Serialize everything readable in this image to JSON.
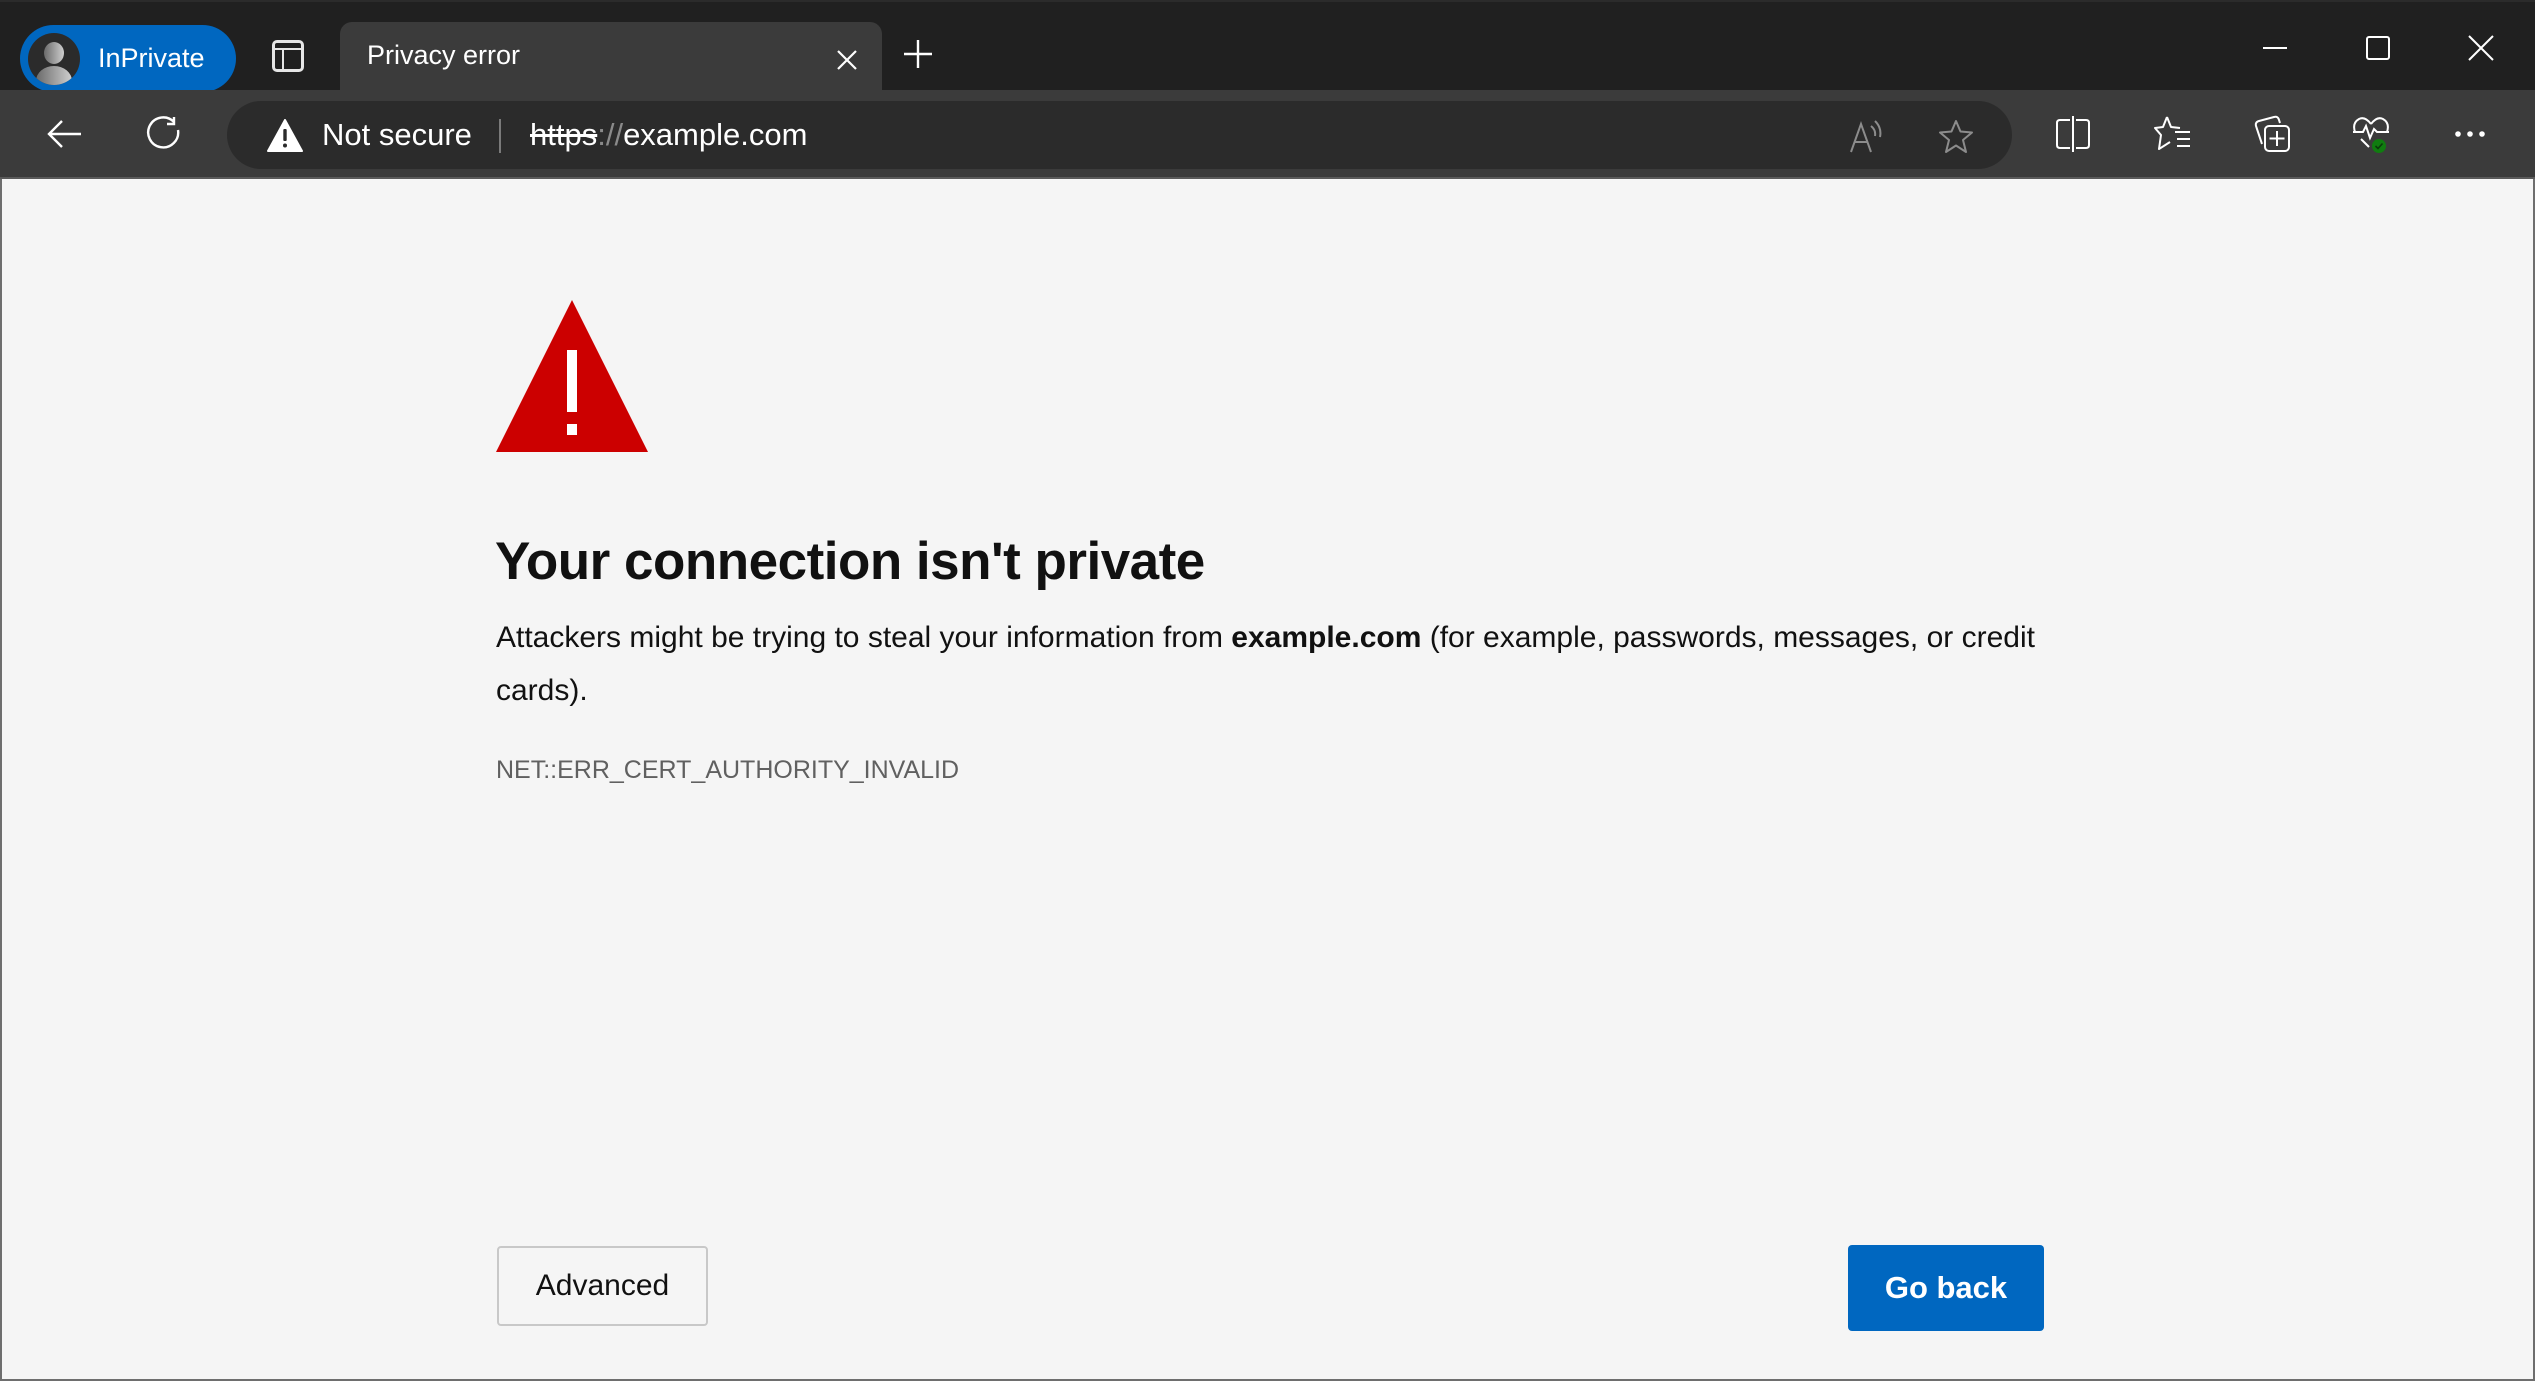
{
  "window": {
    "profile_label": "InPrivate",
    "tab": {
      "title": "Privacy error"
    }
  },
  "toolbar": {
    "security_label": "Not secure",
    "url_scheme": "https",
    "url_sep": "://",
    "url_host": "example.com",
    "icons": [
      "back-icon",
      "refresh-icon",
      "read-aloud-icon",
      "favorite-star-icon",
      "split-screen-icon",
      "favorites-icon",
      "collections-icon",
      "browser-essentials-icon",
      "more-icon"
    ]
  },
  "page": {
    "heading": "Your connection isn't private",
    "desc_before": "Attackers might be trying to steal your information from ",
    "desc_host": "example.com",
    "desc_after": " (for example, passwords, messages, or credit cards).",
    "error_code": "NET::ERR_CERT_AUTHORITY_INVALID",
    "advanced_label": "Advanced",
    "go_back_label": "Go back"
  },
  "colors": {
    "accent": "#0067c0",
    "warning_red": "#cc0000",
    "health_badge": "#107c10"
  }
}
